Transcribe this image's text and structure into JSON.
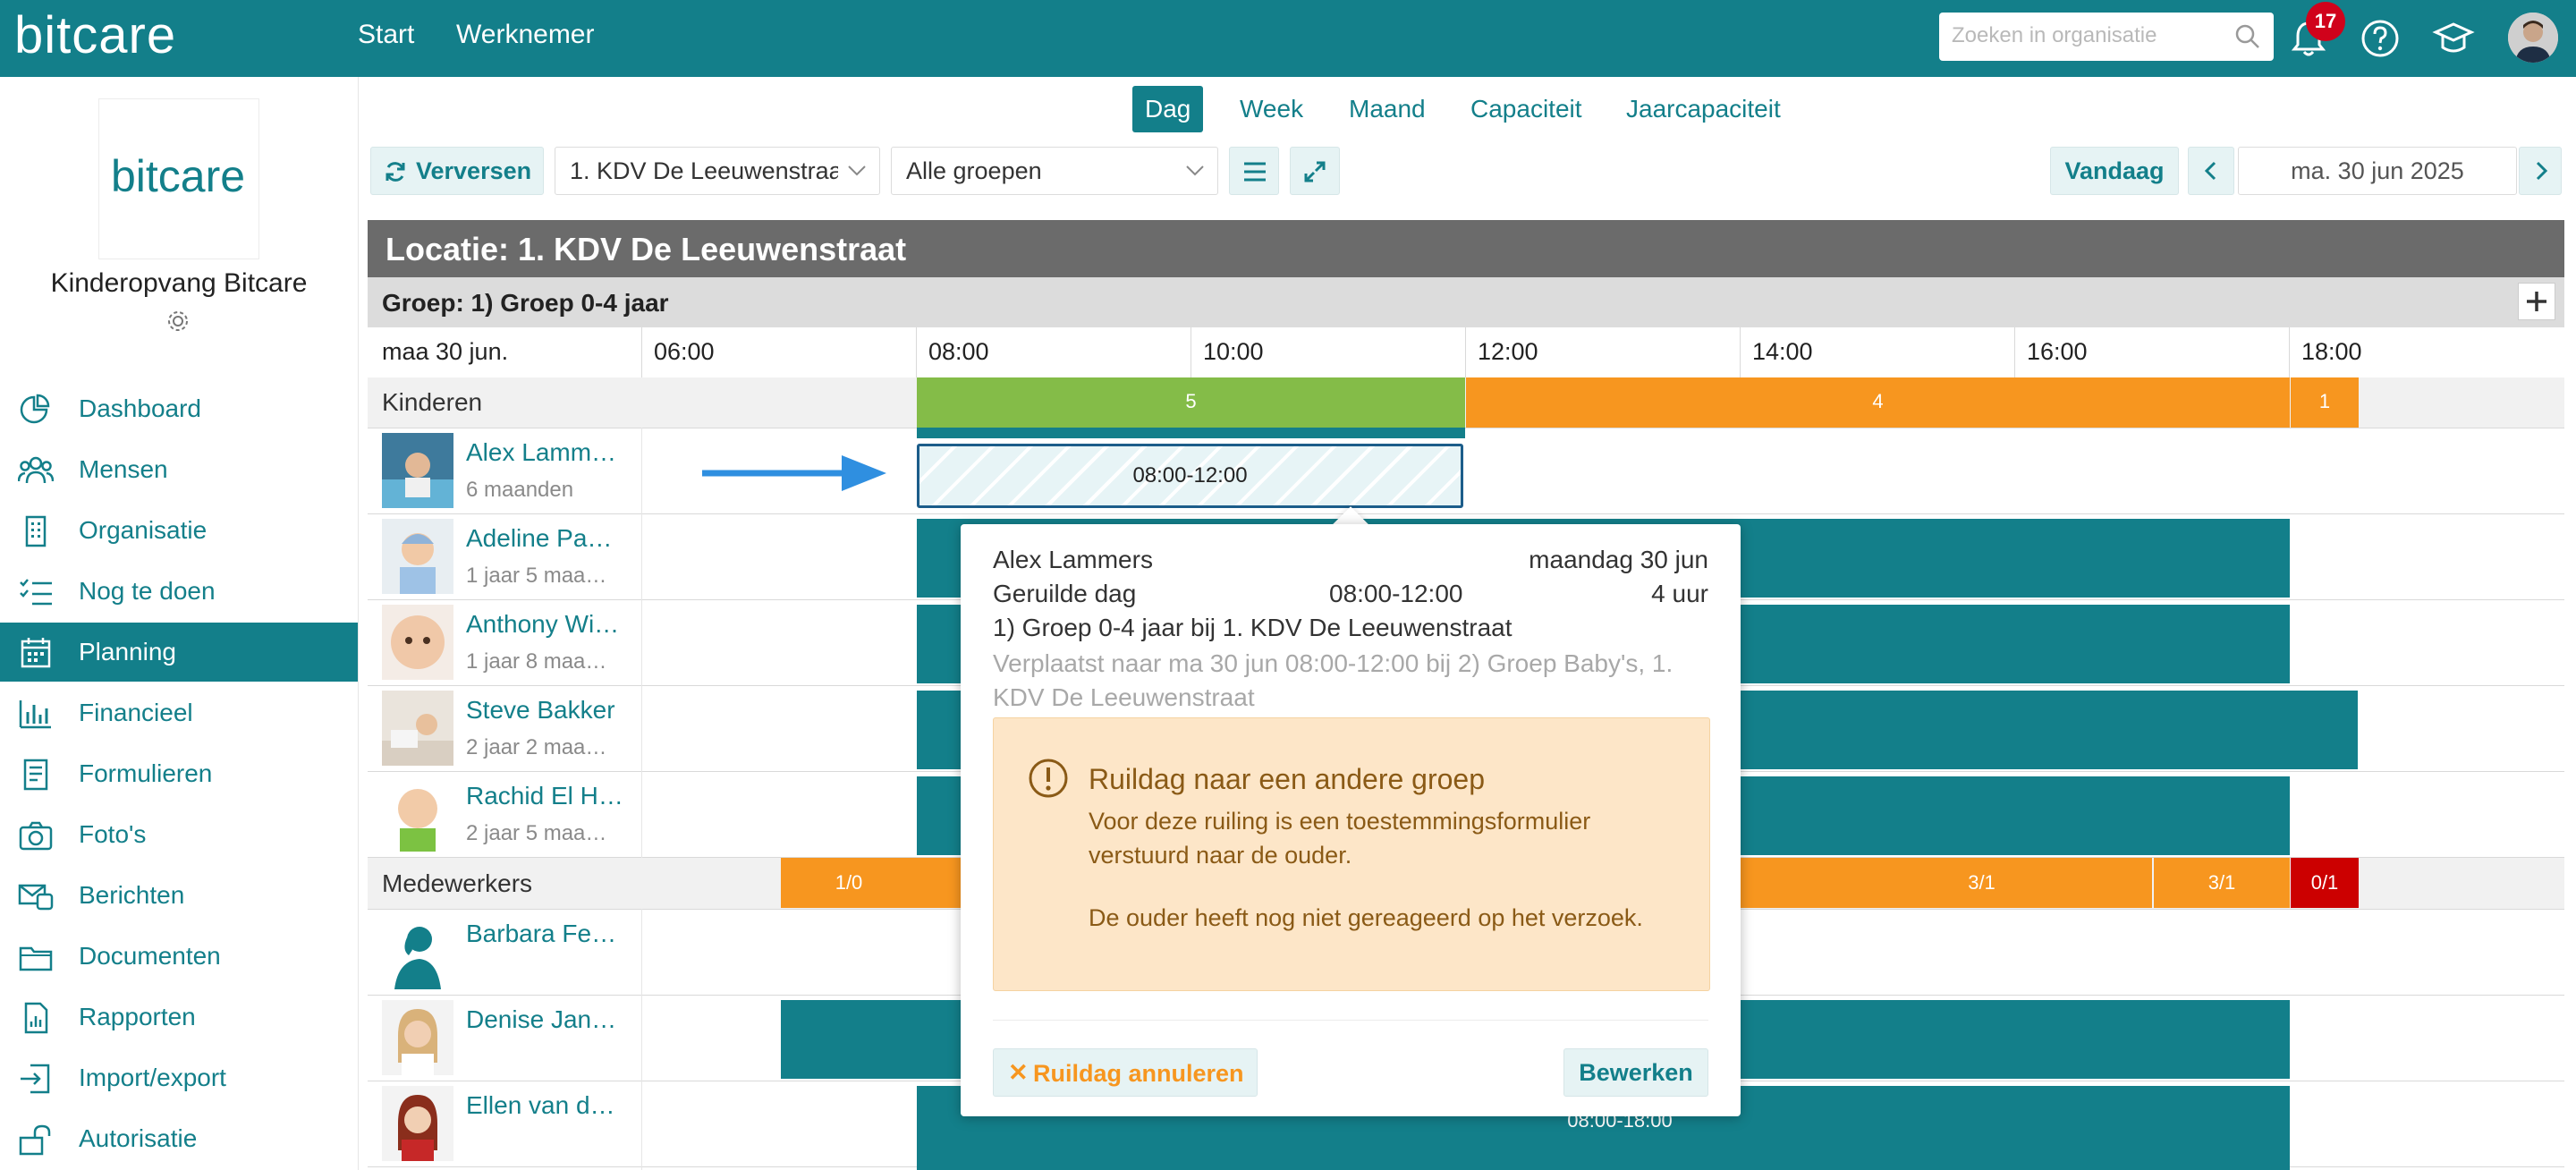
{
  "app": {
    "logo": "bitcare",
    "nav": [
      "Start",
      "Werknemer"
    ]
  },
  "search": {
    "placeholder": "Zoeken in organisatie"
  },
  "notifications": {
    "count": "17"
  },
  "sidebar": {
    "org_logo_text": "bitcare",
    "org_name": "Kinderopvang Bitcare",
    "items": [
      {
        "label": "Dashboard",
        "icon": "pie-chart-icon"
      },
      {
        "label": "Mensen",
        "icon": "people-icon"
      },
      {
        "label": "Organisatie",
        "icon": "building-icon"
      },
      {
        "label": "Nog te doen",
        "icon": "checklist-icon"
      },
      {
        "label": "Planning",
        "icon": "calendar-icon"
      },
      {
        "label": "Financieel",
        "icon": "bar-chart-icon"
      },
      {
        "label": "Formulieren",
        "icon": "form-icon"
      },
      {
        "label": "Foto's",
        "icon": "camera-icon"
      },
      {
        "label": "Berichten",
        "icon": "messages-icon"
      },
      {
        "label": "Documenten",
        "icon": "folder-icon"
      },
      {
        "label": "Rapporten",
        "icon": "report-icon"
      },
      {
        "label": "Import/export",
        "icon": "import-icon"
      },
      {
        "label": "Autorisatie",
        "icon": "lock-icon"
      }
    ],
    "active": "Planning"
  },
  "view_tabs": [
    "Dag",
    "Week",
    "Maand",
    "Capaciteit",
    "Jaarcapaciteit"
  ],
  "toolbar": {
    "refresh": "Verversen",
    "location_select": "1. KDV De Leeuwenstraat",
    "group_select": "Alle groepen",
    "today": "Vandaag",
    "date": "ma. 30 jun 2025"
  },
  "planning": {
    "location_title": "Locatie: 1. KDV De Leeuwenstraat",
    "group_title": "Groep: 1) Groep 0-4 jaar",
    "day_label": "maa 30 jun.",
    "times": [
      "06:00",
      "08:00",
      "10:00",
      "12:00",
      "14:00",
      "16:00",
      "18:00"
    ],
    "kinderen_label": "Kinderen",
    "kinderen_counts": [
      "5",
      "4",
      "1"
    ],
    "children": [
      {
        "name": "Alex Lamm…",
        "age": "6 maanden",
        "block": "08:00-12:00"
      },
      {
        "name": "Adeline Pa…",
        "age": "1 jaar 5 maa…"
      },
      {
        "name": "Anthony Wi…",
        "age": "1 jaar 8 maa…"
      },
      {
        "name": "Steve Bakker",
        "age": "2 jaar 2 maa…"
      },
      {
        "name": "Rachid El H…",
        "age": "2 jaar 5 maa…"
      }
    ],
    "medewerkers_label": "Medewerkers",
    "medewerkers_counts": [
      "1/0",
      "3/1",
      "3/1",
      "0/1"
    ],
    "staff": [
      {
        "name": "Barbara Fe…"
      },
      {
        "name": "Denise Jan…"
      },
      {
        "name": "Ellen van d…",
        "block": "08:00-18:00"
      }
    ]
  },
  "popover": {
    "name": "Alex Lammers",
    "date": "maandag 30 jun",
    "type": "Geruilde dag",
    "time": "08:00-12:00",
    "hours": "4 uur",
    "group_line": "1) Groep 0-4 jaar bij 1. KDV De Leeuwenstraat",
    "moved_line1": "Verplaatst naar ma 30 jun 08:00-12:00 bij 2) Groep Baby's, 1.",
    "moved_line2": "KDV De Leeuwenstraat",
    "warning_title": "Ruildag naar een andere groep",
    "warning_line1": "Voor deze ruiling is een toestemmingsformulier",
    "warning_line2": "verstuurd naar de ouder.",
    "warning_line3": "De ouder heeft nog niet gereageerd op het verzoek.",
    "cancel_button": "Ruildag annuleren",
    "edit_button": "Bewerken"
  },
  "colors": {
    "teal": "#137f8a",
    "green": "#84bc48",
    "orange": "#f7961f",
    "red": "#cc0000"
  }
}
